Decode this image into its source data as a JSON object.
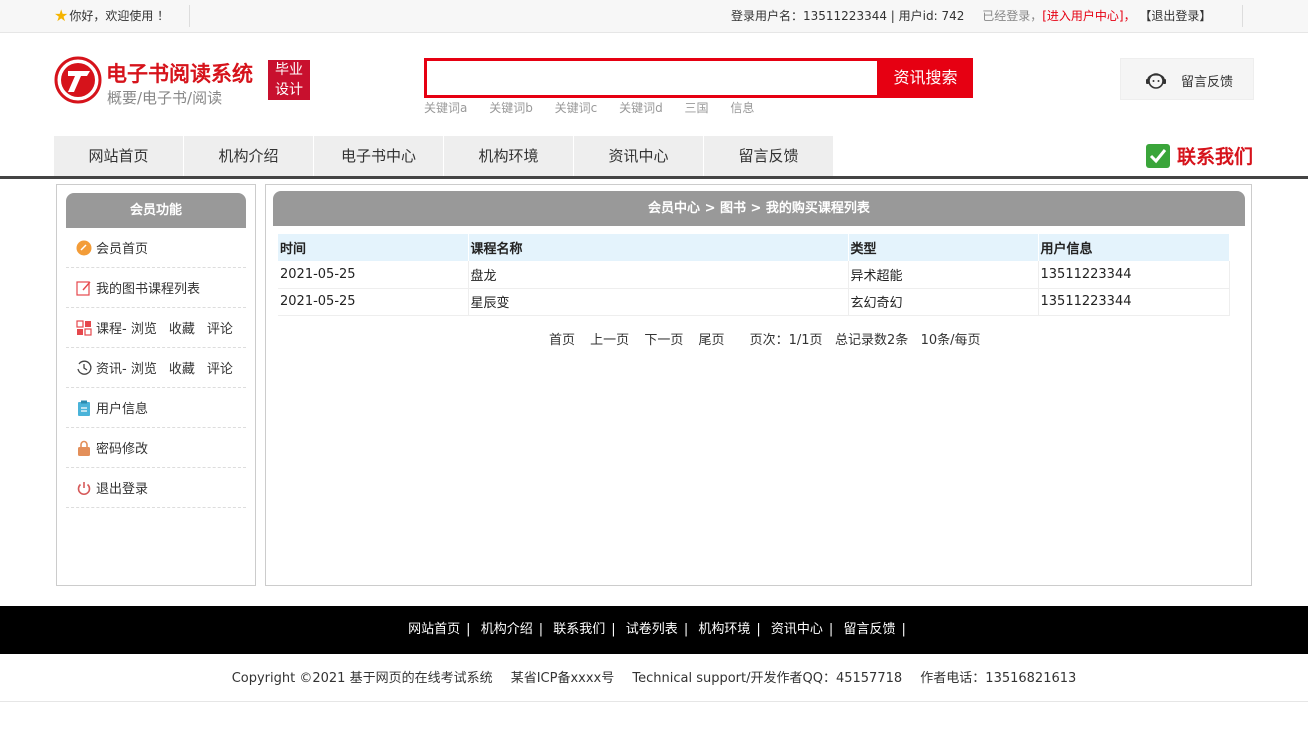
{
  "topbar": {
    "welcome": "你好，欢迎使用 ！",
    "user_label": "登录用户名：13511223344 | 用户id: 742",
    "status": "已经登录，",
    "enter_center": "[进入用户中心]，",
    "logout": "【退出登录】"
  },
  "header": {
    "title": "电子书阅读系统",
    "subtitle": "概要/电子书/阅读",
    "badge_line1": "毕业",
    "badge_line2": "设计",
    "search_placeholder": "",
    "search_button": "资讯搜索",
    "keywords": [
      "关键词a",
      "关键词b",
      "关键词c",
      "关键词d",
      "三国",
      "信息"
    ],
    "feedback": "留言反馈"
  },
  "nav": {
    "items": [
      "网站首页",
      "机构介绍",
      "电子书中心",
      "机构环境",
      "资讯中心",
      "留言反馈"
    ],
    "contact": "联系我们"
  },
  "sidebar": {
    "title": "会员功能",
    "items": [
      {
        "label": "会员首页",
        "icon": "home-icon"
      },
      {
        "label": "我的图书课程列表",
        "icon": "edit-icon"
      },
      {
        "label": "课程- 浏览",
        "extra1": "收藏",
        "extra2": "评论",
        "icon": "grid-icon"
      },
      {
        "label": "资讯- 浏览",
        "extra1": "收藏",
        "extra2": "评论",
        "icon": "history-icon"
      },
      {
        "label": "用户信息",
        "icon": "clipboard-icon"
      },
      {
        "label": "密码修改",
        "icon": "lock-icon"
      },
      {
        "label": "退出登录",
        "icon": "power-icon"
      }
    ]
  },
  "main": {
    "breadcrumb": "会员中心 > 图书 > 我的购买课程列表",
    "columns": [
      "时间",
      "课程名称",
      "类型",
      "用户信息"
    ],
    "rows": [
      [
        "2021-05-25",
        "盘龙",
        "异术超能",
        "13511223344"
      ],
      [
        "2021-05-25",
        "星辰变",
        "玄幻奇幻",
        "13511223344"
      ]
    ],
    "pager": {
      "first": "首页",
      "prev": "上一页",
      "next": "下一页",
      "last": "尾页",
      "info": "页次：1/1页   总记录数2条   10条/每页"
    }
  },
  "footer": {
    "links": [
      "网站首页",
      "机构介绍",
      "联系我们",
      "试卷列表",
      "机构环境",
      "资讯中心",
      "留言反馈"
    ],
    "copyright": "Copyright ©2021 基于网页的在线考试系统",
    "icp": "某省ICP备xxxx号",
    "support": "Technical support/开发作者QQ：45157718",
    "phone": "作者电话：13516821613"
  },
  "colors": {
    "brand_red": "#e60012",
    "header_gray": "#999999",
    "table_head": "#e4f3fc"
  }
}
